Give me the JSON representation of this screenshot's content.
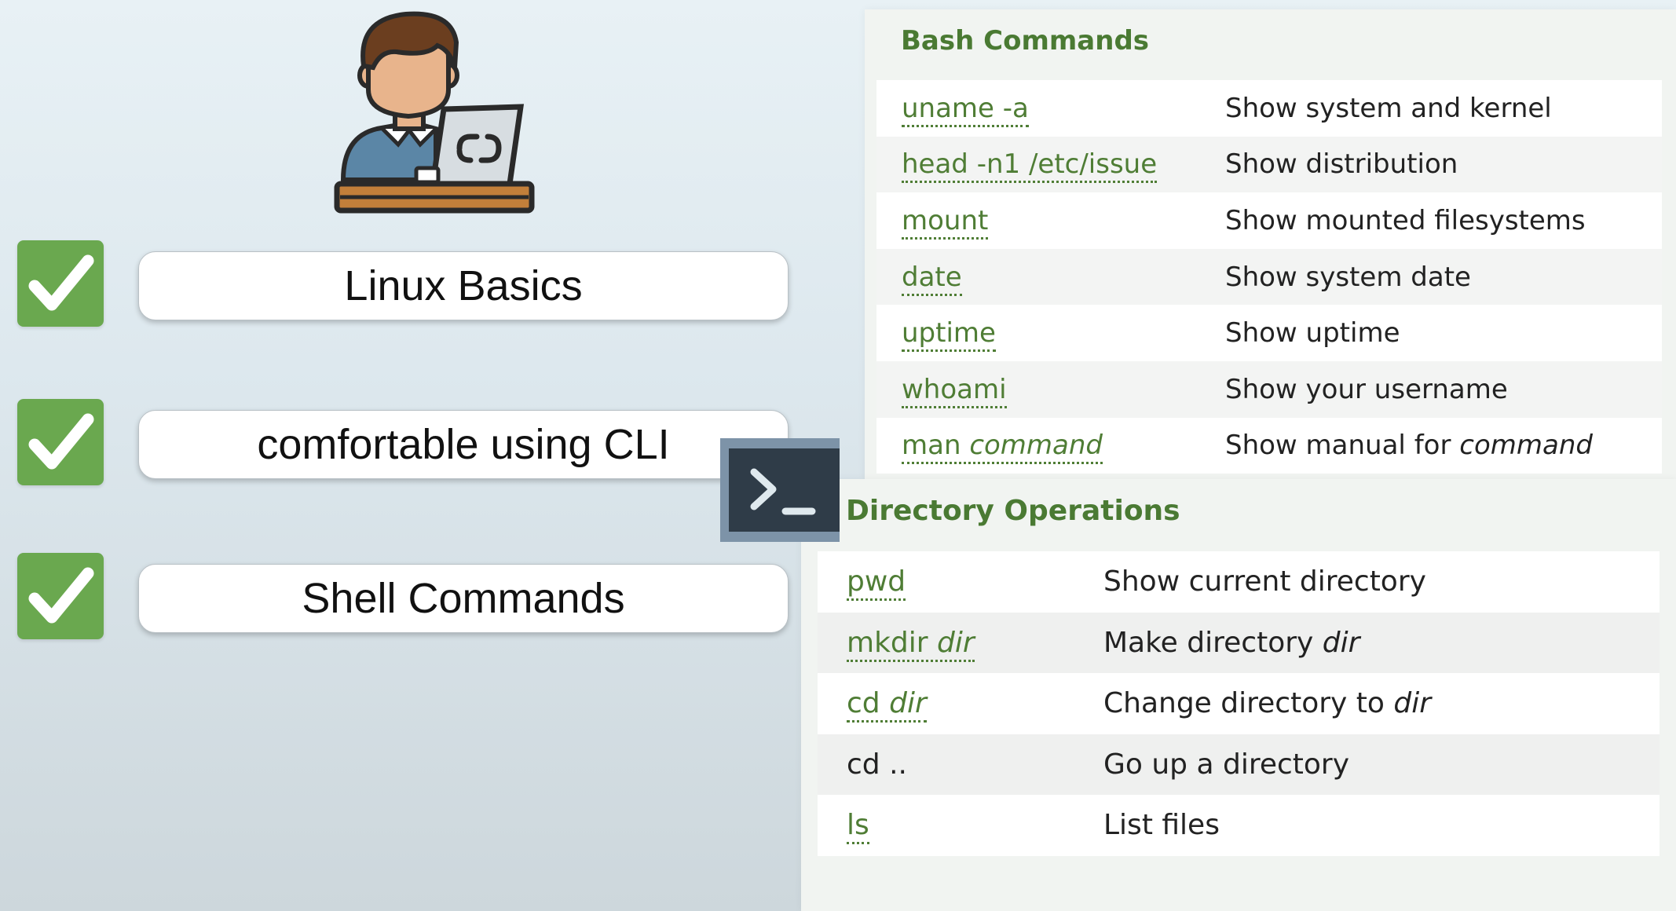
{
  "checklist": [
    {
      "label": "Linux Basics"
    },
    {
      "label": "comfortable using CLI"
    },
    {
      "label": "Shell Commands"
    }
  ],
  "icons": {
    "avatar": "person-at-laptop-icon",
    "check": "checkmark-icon",
    "terminal": "terminal-prompt-icon"
  },
  "colors": {
    "check_green": "#6aa84f",
    "heading_green": "#4a7a33",
    "link_green": "#4f7d35",
    "terminal_frame": "#7d93a8",
    "terminal_screen": "#2f3c48"
  },
  "bash": {
    "title": "Bash Commands",
    "rows": [
      {
        "cmd": "uname -a",
        "cmd_arg": "",
        "desc": "Show system and kernel",
        "desc_arg": ""
      },
      {
        "cmd": "head -n1 /etc/issue",
        "cmd_arg": "",
        "desc": "Show distribution",
        "desc_arg": ""
      },
      {
        "cmd": "mount",
        "cmd_arg": "",
        "desc": "Show mounted filesystems",
        "desc_arg": ""
      },
      {
        "cmd": "date",
        "cmd_arg": "",
        "desc": "Show system date",
        "desc_arg": ""
      },
      {
        "cmd": "uptime",
        "cmd_arg": "",
        "desc": "Show uptime",
        "desc_arg": ""
      },
      {
        "cmd": "whoami",
        "cmd_arg": "",
        "desc": "Show your username",
        "desc_arg": ""
      },
      {
        "cmd": "man ",
        "cmd_arg": "command",
        "desc": "Show manual for ",
        "desc_arg": "command"
      }
    ]
  },
  "dirs": {
    "title": "Directory Operations",
    "rows": [
      {
        "cmd": "pwd",
        "cmd_arg": "",
        "desc": "Show current directory",
        "desc_arg": ""
      },
      {
        "cmd": "mkdir ",
        "cmd_arg": "dir",
        "desc": "Make directory ",
        "desc_arg": "dir"
      },
      {
        "cmd": "cd ",
        "cmd_arg": "dir",
        "desc": "Change directory to ",
        "desc_arg": "dir"
      },
      {
        "cmd": "cd ..",
        "cmd_arg": "",
        "desc": "Go up a directory",
        "desc_arg": ""
      },
      {
        "cmd": "ls",
        "cmd_arg": "",
        "desc": "List files",
        "desc_arg": ""
      }
    ]
  }
}
